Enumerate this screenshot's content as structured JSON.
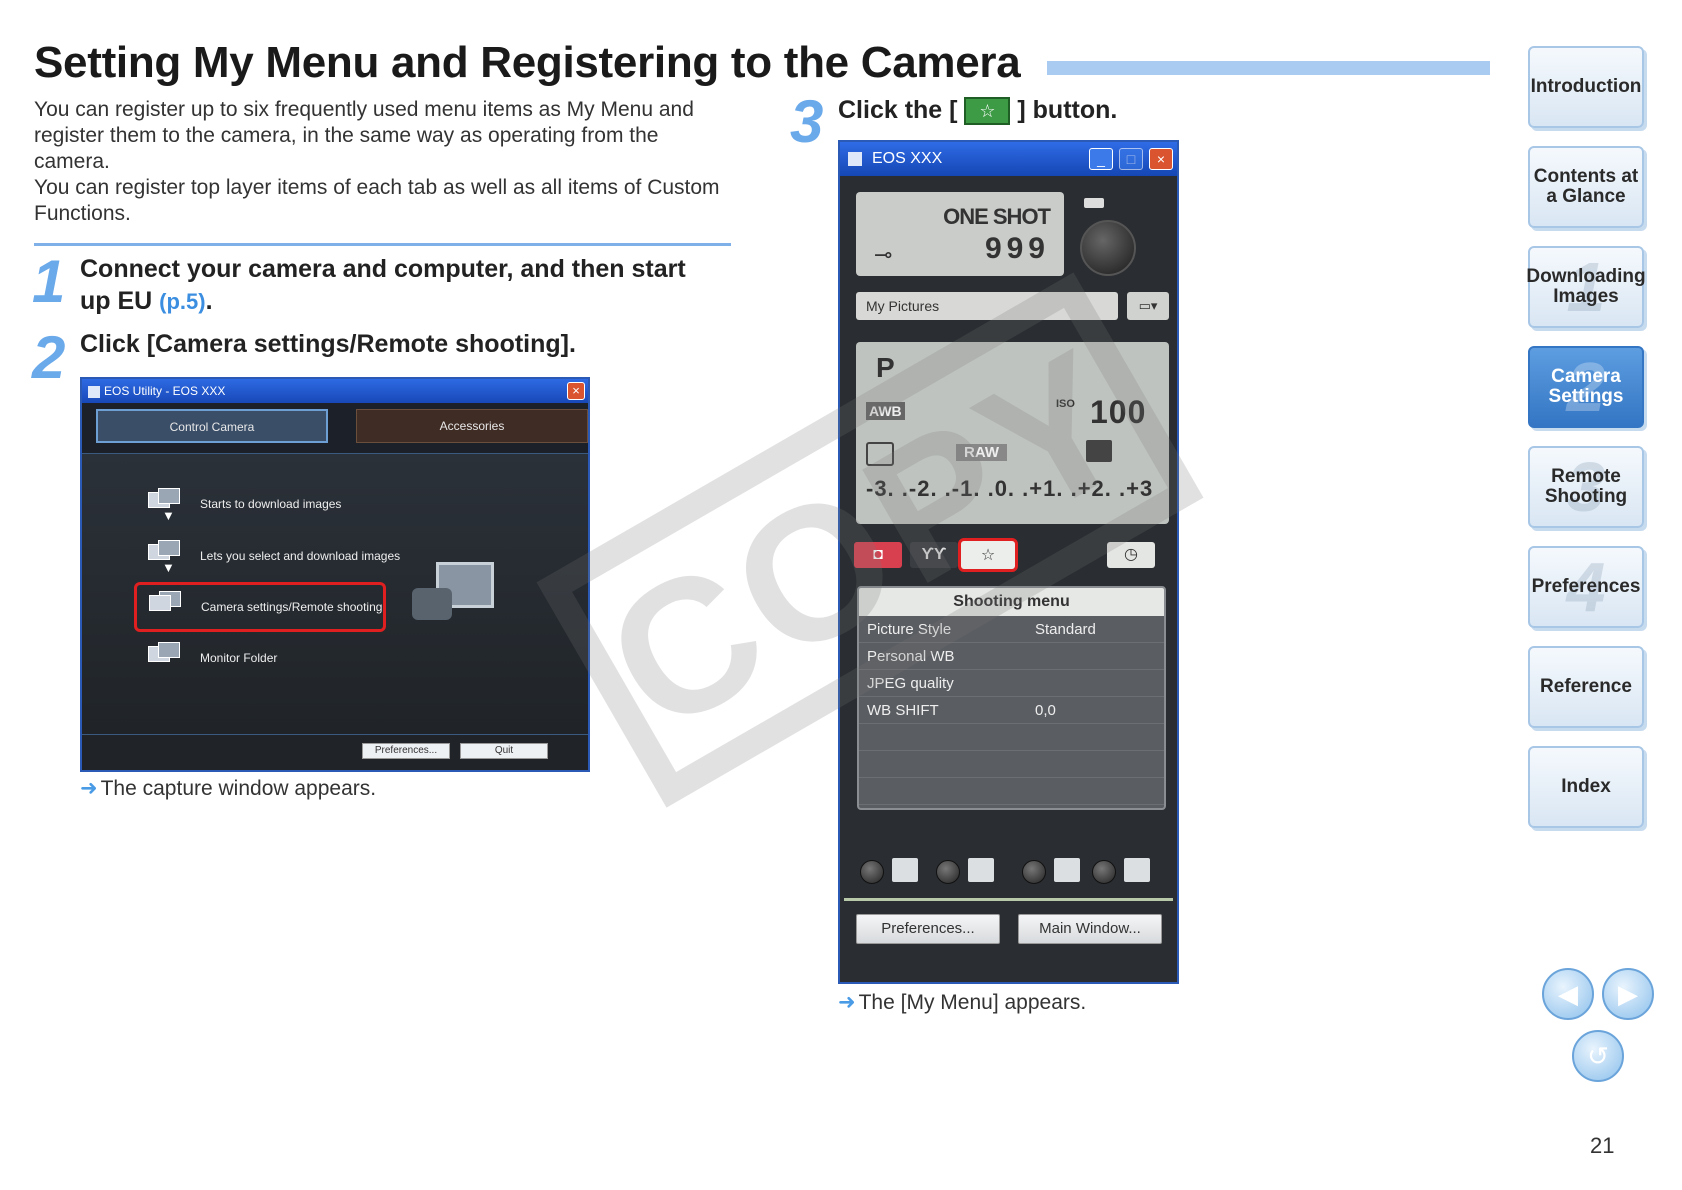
{
  "title": "Setting My Menu and Registering to the Camera",
  "intro": [
    "You can register up to six frequently used menu items as My Menu and register them to the camera, in the same way as operating from the camera.",
    "You can register top layer items of each tab as well as all items of Custom Functions."
  ],
  "steps": [
    {
      "num": "1",
      "text": "Connect your camera and computer, and then start up EU",
      "link": "(p.5)",
      "tail": "."
    },
    {
      "num": "2",
      "text": "Click [Camera settings/Remote shooting]."
    },
    {
      "num": "3",
      "text_before": "Click the [",
      "text_after": "] button."
    }
  ],
  "results": {
    "step2": "The capture window appears.",
    "step3": "The [My Menu] appears."
  },
  "eos_utility": {
    "title": "EOS Utility - EOS XXX",
    "tabs": [
      "Control Camera",
      "Accessories"
    ],
    "items": [
      "Starts to download images",
      "Lets you select and download images",
      "Camera settings/Remote shooting",
      "Monitor Folder"
    ],
    "buttons": {
      "preferences": "Preferences...",
      "quit": "Quit"
    }
  },
  "capture_window": {
    "title": "EOS XXX",
    "drive_mode": "ONE SHOT",
    "shots": "999",
    "folder": "My Pictures",
    "shooting_mode": "P",
    "wb": "AWB",
    "iso_label": "ISO",
    "iso": "100",
    "quality": "RAW",
    "exposure_scale": "-3. .-2. .-1. .0. .+1. .+2. .+3",
    "menu_header": "Shooting menu",
    "menu_rows": [
      {
        "label": "Picture Style",
        "value": "Standard"
      },
      {
        "label": "Personal WB",
        "value": ""
      },
      {
        "label": "JPEG quality",
        "value": ""
      },
      {
        "label": "WB SHIFT",
        "value": "0,0"
      },
      {
        "label": "",
        "value": ""
      },
      {
        "label": "",
        "value": ""
      },
      {
        "label": "",
        "value": ""
      }
    ],
    "buttons": {
      "preferences": "Preferences...",
      "main_window": "Main Window..."
    }
  },
  "watermark": "COPY",
  "sidebar": [
    {
      "label": "Introduction",
      "ghost": ""
    },
    {
      "label": "Contents at a Glance",
      "ghost": ""
    },
    {
      "label": "Downloading Images",
      "ghost": "1"
    },
    {
      "label": "Camera Settings",
      "ghost": "2",
      "active": true
    },
    {
      "label": "Remote Shooting",
      "ghost": "3"
    },
    {
      "label": "Preferences",
      "ghost": "4"
    },
    {
      "label": "Reference",
      "ghost": ""
    },
    {
      "label": "Index",
      "ghost": ""
    }
  ],
  "page_number": "21"
}
